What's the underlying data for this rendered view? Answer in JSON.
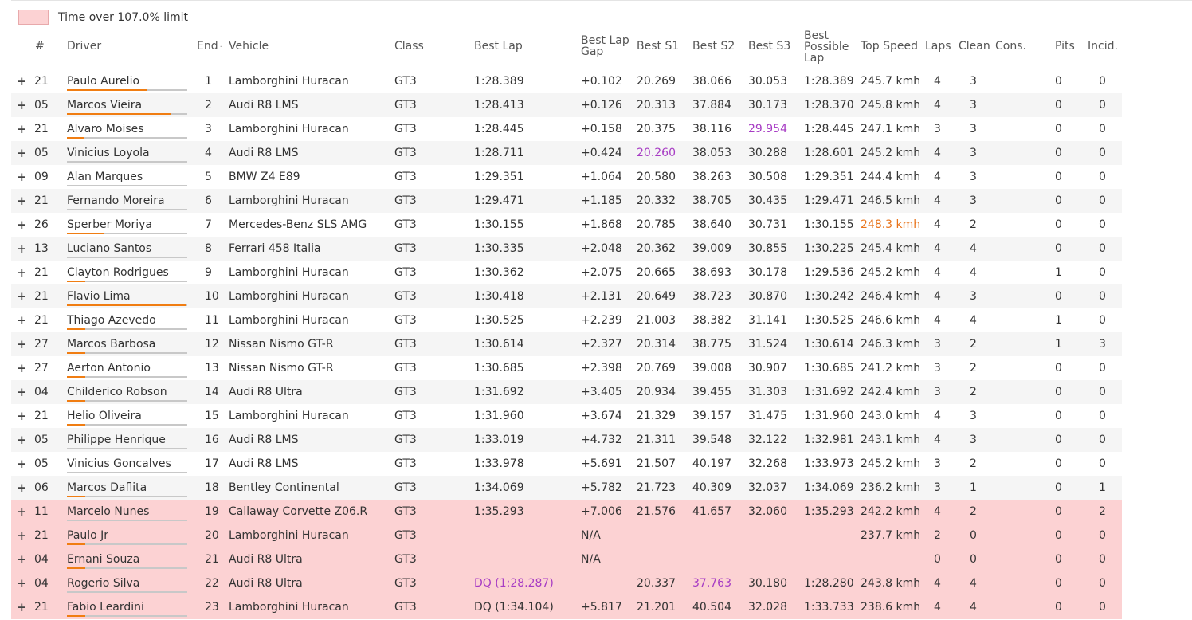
{
  "legend": {
    "text": "Time over 107.0% limit",
    "color": "#fcd2d3"
  },
  "headers": {
    "num": "#",
    "driver": "Driver",
    "end": "End",
    "sort_indicator": "·",
    "vehicle": "Vehicle",
    "class": "Class",
    "best_lap": "Best Lap",
    "best_lap_gap_1": "Best Lap",
    "best_lap_gap_2": "Gap",
    "best_s1": "Best S1",
    "best_s2": "Best S2",
    "best_s3": "Best S3",
    "best_possible_1": "Best",
    "best_possible_2": "Possible",
    "best_possible_3": "Lap",
    "top_speed": "Top Speed",
    "laps": "Laps",
    "clean": "Clean",
    "cons": "Cons.",
    "pits": "Pits",
    "incid": "Incid."
  },
  "expand_icon": "+",
  "colors": {
    "highlight_purple": "#a73cc4",
    "highlight_orange": "#e8731a",
    "progress": "#f07d12"
  },
  "rows": [
    {
      "num": "21",
      "driver": "Paulo Aurelio",
      "progress": 0.67,
      "end": "1",
      "vehicle": "Lamborghini Huracan",
      "class": "GT3",
      "best": "1:28.389",
      "gap": "+0.102",
      "s1": "20.269",
      "s2": "38.066",
      "s3": "30.053",
      "bpl": "1:28.389",
      "speed": "245.7 kmh",
      "laps": "4",
      "clean": "3",
      "pits": "0",
      "incid": "0",
      "over": false
    },
    {
      "num": "05",
      "driver": "Marcos Vieira",
      "progress": 0.86,
      "end": "2",
      "vehicle": "Audi R8 LMS",
      "class": "GT3",
      "best": "1:28.413",
      "gap": "+0.126",
      "s1": "20.313",
      "s2": "37.884",
      "s3": "30.173",
      "bpl": "1:28.370",
      "speed": "245.8 kmh",
      "laps": "4",
      "clean": "3",
      "pits": "0",
      "incid": "0",
      "over": false
    },
    {
      "num": "21",
      "driver": "Alvaro Moises",
      "progress": 0.14,
      "end": "3",
      "vehicle": "Lamborghini Huracan",
      "class": "GT3",
      "best": "1:28.445",
      "gap": "+0.158",
      "s1": "20.375",
      "s2": "38.116",
      "s3": "29.954",
      "s3_color": "purple",
      "bpl": "1:28.445",
      "speed": "247.1 kmh",
      "laps": "3",
      "clean": "3",
      "pits": "0",
      "incid": "0",
      "over": false
    },
    {
      "num": "05",
      "driver": "Vinicius Loyola",
      "progress": 0.0,
      "end": "4",
      "vehicle": "Audi R8 LMS",
      "class": "GT3",
      "best": "1:28.711",
      "gap": "+0.424",
      "s1": "20.260",
      "s1_color": "purple",
      "s2": "38.053",
      "s3": "30.288",
      "bpl": "1:28.601",
      "speed": "245.2 kmh",
      "laps": "4",
      "clean": "3",
      "pits": "0",
      "incid": "0",
      "over": false
    },
    {
      "num": "09",
      "driver": "Alan Marques",
      "progress": 0.0,
      "end": "5",
      "vehicle": "BMW Z4 E89",
      "class": "GT3",
      "best": "1:29.351",
      "gap": "+1.064",
      "s1": "20.580",
      "s2": "38.263",
      "s3": "30.508",
      "bpl": "1:29.351",
      "speed": "244.4 kmh",
      "laps": "4",
      "clean": "3",
      "pits": "0",
      "incid": "0",
      "over": false
    },
    {
      "num": "21",
      "driver": "Fernando Moreira",
      "progress": 0.0,
      "end": "6",
      "vehicle": "Lamborghini Huracan",
      "class": "GT3",
      "best": "1:29.471",
      "gap": "+1.185",
      "s1": "20.332",
      "s2": "38.705",
      "s3": "30.435",
      "bpl": "1:29.471",
      "speed": "246.5 kmh",
      "laps": "4",
      "clean": "3",
      "pits": "0",
      "incid": "0",
      "over": false
    },
    {
      "num": "26",
      "driver": "Sperber Moriya",
      "progress": 0.31,
      "end": "7",
      "vehicle": "Mercedes-Benz SLS AMG",
      "class": "GT3",
      "best": "1:30.155",
      "gap": "+1.868",
      "s1": "20.785",
      "s2": "38.640",
      "s3": "30.731",
      "bpl": "1:30.155",
      "speed": "248.3 kmh",
      "speed_color": "orange",
      "laps": "4",
      "clean": "2",
      "pits": "0",
      "incid": "0",
      "over": false
    },
    {
      "num": "13",
      "driver": "Luciano Santos",
      "progress": 0.0,
      "end": "8",
      "vehicle": "Ferrari 458 Italia",
      "class": "GT3",
      "best": "1:30.335",
      "gap": "+2.048",
      "s1": "20.362",
      "s2": "39.009",
      "s3": "30.855",
      "bpl": "1:30.225",
      "speed": "245.4 kmh",
      "laps": "4",
      "clean": "4",
      "pits": "0",
      "incid": "0",
      "over": false
    },
    {
      "num": "21",
      "driver": "Clayton Rodrigues",
      "progress": 0.15,
      "end": "9",
      "vehicle": "Lamborghini Huracan",
      "class": "GT3",
      "best": "1:30.362",
      "gap": "+2.075",
      "s1": "20.665",
      "s2": "38.693",
      "s3": "30.178",
      "bpl": "1:29.536",
      "speed": "245.2 kmh",
      "laps": "4",
      "clean": "4",
      "pits": "1",
      "incid": "0",
      "over": false
    },
    {
      "num": "21",
      "driver": "Flavio Lima",
      "progress": 0.99,
      "end": "10",
      "vehicle": "Lamborghini Huracan",
      "class": "GT3",
      "best": "1:30.418",
      "gap": "+2.131",
      "s1": "20.649",
      "s2": "38.723",
      "s3": "30.870",
      "bpl": "1:30.242",
      "speed": "246.4 kmh",
      "laps": "4",
      "clean": "3",
      "pits": "0",
      "incid": "0",
      "over": false
    },
    {
      "num": "21",
      "driver": "Thiago Azevedo",
      "progress": 0.15,
      "end": "11",
      "vehicle": "Lamborghini Huracan",
      "class": "GT3",
      "best": "1:30.525",
      "gap": "+2.239",
      "s1": "21.003",
      "s2": "38.382",
      "s3": "31.141",
      "bpl": "1:30.525",
      "speed": "246.6 kmh",
      "laps": "4",
      "clean": "4",
      "pits": "1",
      "incid": "0",
      "over": false
    },
    {
      "num": "27",
      "driver": "Marcos Barbosa",
      "progress": 0.15,
      "end": "12",
      "vehicle": "Nissan Nismo GT-R",
      "class": "GT3",
      "best": "1:30.614",
      "gap": "+2.327",
      "s1": "20.314",
      "s2": "38.775",
      "s3": "31.524",
      "bpl": "1:30.614",
      "speed": "246.3 kmh",
      "laps": "3",
      "clean": "2",
      "pits": "1",
      "incid": "3",
      "over": false
    },
    {
      "num": "27",
      "driver": "Aerton Antonio",
      "progress": 0.15,
      "end": "13",
      "vehicle": "Nissan Nismo GT-R",
      "class": "GT3",
      "best": "1:30.685",
      "gap": "+2.398",
      "s1": "20.769",
      "s2": "39.008",
      "s3": "30.907",
      "bpl": "1:30.685",
      "speed": "241.2 kmh",
      "laps": "3",
      "clean": "2",
      "pits": "0",
      "incid": "0",
      "over": false
    },
    {
      "num": "04",
      "driver": "Childerico Robson",
      "progress": 0.15,
      "end": "14",
      "vehicle": "Audi R8 Ultra",
      "class": "GT3",
      "best": "1:31.692",
      "gap": "+3.405",
      "s1": "20.934",
      "s2": "39.455",
      "s3": "31.303",
      "bpl": "1:31.692",
      "speed": "242.4 kmh",
      "laps": "3",
      "clean": "2",
      "pits": "0",
      "incid": "0",
      "over": false
    },
    {
      "num": "21",
      "driver": "Helio Oliveira",
      "progress": 0.15,
      "end": "15",
      "vehicle": "Lamborghini Huracan",
      "class": "GT3",
      "best": "1:31.960",
      "gap": "+3.674",
      "s1": "21.329",
      "s2": "39.157",
      "s3": "31.475",
      "bpl": "1:31.960",
      "speed": "243.0 kmh",
      "laps": "4",
      "clean": "3",
      "pits": "0",
      "incid": "0",
      "over": false
    },
    {
      "num": "05",
      "driver": "Philippe Henrique",
      "progress": 0.0,
      "end": "16",
      "vehicle": "Audi R8 LMS",
      "class": "GT3",
      "best": "1:33.019",
      "gap": "+4.732",
      "s1": "21.311",
      "s2": "39.548",
      "s3": "32.122",
      "bpl": "1:32.981",
      "speed": "243.1 kmh",
      "laps": "4",
      "clean": "3",
      "pits": "0",
      "incid": "0",
      "over": false
    },
    {
      "num": "05",
      "driver": "Vinicius Goncalves",
      "progress": 0.0,
      "end": "17",
      "vehicle": "Audi R8 LMS",
      "class": "GT3",
      "best": "1:33.978",
      "gap": "+5.691",
      "s1": "21.507",
      "s2": "40.197",
      "s3": "32.268",
      "bpl": "1:33.973",
      "speed": "245.2 kmh",
      "laps": "3",
      "clean": "2",
      "pits": "0",
      "incid": "0",
      "over": false
    },
    {
      "num": "06",
      "driver": "Marcos Daflita",
      "progress": 0.15,
      "end": "18",
      "vehicle": "Bentley Continental",
      "class": "GT3",
      "best": "1:34.069",
      "gap": "+5.782",
      "s1": "21.723",
      "s2": "40.309",
      "s3": "32.037",
      "bpl": "1:34.069",
      "speed": "236.2 kmh",
      "laps": "3",
      "clean": "1",
      "pits": "0",
      "incid": "1",
      "over": false
    },
    {
      "num": "11",
      "driver": "Marcelo Nunes",
      "progress": 0.0,
      "end": "19",
      "vehicle": "Callaway Corvette Z06.R",
      "class": "GT3",
      "best": "1:35.293",
      "gap": "+7.006",
      "s1": "21.576",
      "s2": "41.657",
      "s3": "32.060",
      "bpl": "1:35.293",
      "speed": "242.2 kmh",
      "laps": "4",
      "clean": "2",
      "pits": "0",
      "incid": "2",
      "over": true
    },
    {
      "num": "21",
      "driver": "Paulo Jr",
      "progress": 0.15,
      "end": "20",
      "vehicle": "Lamborghini Huracan",
      "class": "GT3",
      "best": "",
      "gap": "N/A",
      "s1": "",
      "s2": "",
      "s3": "",
      "bpl": "",
      "speed": "237.7 kmh",
      "laps": "2",
      "clean": "0",
      "pits": "0",
      "incid": "0",
      "over": true
    },
    {
      "num": "04",
      "driver": "Ernani Souza",
      "progress": 0.15,
      "end": "21",
      "vehicle": "Audi R8 Ultra",
      "class": "GT3",
      "best": "",
      "gap": "N/A",
      "s1": "",
      "s2": "",
      "s3": "",
      "bpl": "",
      "speed": "",
      "laps": "0",
      "clean": "0",
      "pits": "0",
      "incid": "0",
      "over": true
    },
    {
      "num": "04",
      "driver": "Rogerio Silva",
      "progress": 0.0,
      "end": "22",
      "vehicle": "Audi R8 Ultra",
      "class": "GT3",
      "best": "DQ (1:28.287)",
      "best_color": "purple",
      "gap": "",
      "s1": "20.337",
      "s2": "37.763",
      "s2_color": "purple",
      "s3": "30.180",
      "bpl": "1:28.280",
      "speed": "243.8 kmh",
      "laps": "4",
      "clean": "4",
      "pits": "0",
      "incid": "0",
      "over": true
    },
    {
      "num": "21",
      "driver": "Fabio Leardini",
      "progress": 0.15,
      "end": "23",
      "vehicle": "Lamborghini Huracan",
      "class": "GT3",
      "best": "DQ (1:34.104)",
      "gap": "+5.817",
      "s1": "21.201",
      "s2": "40.504",
      "s3": "32.028",
      "bpl": "1:33.733",
      "speed": "238.6 kmh",
      "laps": "4",
      "clean": "4",
      "pits": "0",
      "incid": "0",
      "over": true
    }
  ]
}
